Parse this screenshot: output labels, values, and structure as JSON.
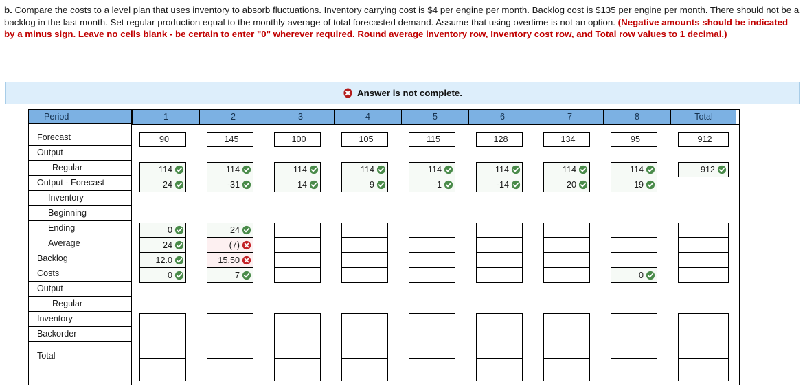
{
  "question": {
    "lead": "b.",
    "body": " Compare the costs to a level plan that uses inventory to absorb fluctuations. Inventory carrying cost is $4 per engine per month. Backlog cost is $135 per engine per month. There should not be a backlog in the last month. Set regular production equal to the monthly average of total forecasted demand. Assume that using overtime is not an option. ",
    "warning": "(Negative amounts should be indicated by a minus sign. Leave no cells blank - be certain to enter \"0\" wherever required. Round average inventory row, Inventory cost row, and Total row values to 1 decimal.)"
  },
  "banner": {
    "icon": "error-circle-x-icon",
    "text": "Answer is not complete."
  },
  "colors": {
    "header_blue": "#7cb1e3",
    "banner_blue": "#ddeefb",
    "correct_green": "#4a8b4a",
    "incorrect_red": "#c32126",
    "warning_red": "#c00000"
  },
  "table": {
    "corner_label": "Period",
    "period_headers": [
      "1",
      "2",
      "3",
      "4",
      "5",
      "6",
      "7",
      "8"
    ],
    "total_header": "Total",
    "row_labels": {
      "forecast": "Forecast",
      "output": "Output",
      "regular": "Regular",
      "output_minus_forecast": "Output - Forecast",
      "inventory": "Inventory",
      "beginning": "Beginning",
      "ending": "Ending",
      "average": "Average",
      "backlog": "Backlog",
      "costs": "Costs",
      "costs_output": "Output",
      "costs_regular": "Regular",
      "costs_inventory": "Inventory",
      "costs_backorder": "Backorder",
      "costs_total": "Total"
    },
    "forecast": {
      "values": [
        "90",
        "145",
        "100",
        "105",
        "115",
        "128",
        "134",
        "95"
      ],
      "total": "912"
    },
    "regular": {
      "values": [
        "114",
        "114",
        "114",
        "114",
        "114",
        "114",
        "114",
        "114"
      ],
      "status": [
        "ok",
        "ok",
        "ok",
        "ok",
        "ok",
        "ok",
        "ok",
        "ok"
      ],
      "total": "912",
      "total_status": "ok"
    },
    "output_minus_forecast": {
      "values": [
        "24",
        "-31",
        "14",
        "9",
        "-1",
        "-14",
        "-20",
        "19"
      ],
      "status": [
        "ok",
        "ok",
        "ok",
        "ok",
        "ok",
        "ok",
        "ok",
        "ok"
      ],
      "total": "",
      "total_status": "empty"
    },
    "beginning": {
      "values": [
        "0",
        "24",
        "",
        "",
        "",
        "",
        "",
        ""
      ],
      "status": [
        "ok",
        "ok",
        "empty",
        "empty",
        "empty",
        "empty",
        "empty",
        "empty"
      ],
      "total": "",
      "total_status": "empty"
    },
    "ending": {
      "values": [
        "24",
        "(7)",
        "",
        "",
        "",
        "",
        "",
        ""
      ],
      "status": [
        "ok",
        "bad",
        "empty",
        "empty",
        "empty",
        "empty",
        "empty",
        "empty"
      ],
      "total": "",
      "total_status": "empty"
    },
    "average": {
      "values": [
        "12.0",
        "15.50",
        "",
        "",
        "",
        "",
        "",
        ""
      ],
      "status": [
        "ok",
        "bad",
        "empty",
        "empty",
        "empty",
        "empty",
        "empty",
        "empty"
      ],
      "total": "",
      "total_status": "empty"
    },
    "backlog": {
      "values": [
        "0",
        "7",
        "",
        "",
        "",
        "",
        "",
        "0"
      ],
      "status": [
        "ok",
        "ok",
        "empty",
        "empty",
        "empty",
        "empty",
        "empty",
        "ok"
      ],
      "total": "",
      "total_status": "empty"
    },
    "costs_regular": {
      "values": [
        "",
        "",
        "",
        "",
        "",
        "",
        "",
        ""
      ],
      "status": [
        "empty",
        "empty",
        "empty",
        "empty",
        "empty",
        "empty",
        "empty",
        "empty"
      ],
      "total": "",
      "total_status": "empty"
    },
    "costs_inventory": {
      "values": [
        "",
        "",
        "",
        "",
        "",
        "",
        "",
        ""
      ],
      "status": [
        "empty",
        "empty",
        "empty",
        "empty",
        "empty",
        "empty",
        "empty",
        "empty"
      ],
      "total": "",
      "total_status": "empty"
    },
    "costs_backorder": {
      "values": [
        "",
        "",
        "",
        "",
        "",
        "",
        "",
        ""
      ],
      "status": [
        "empty",
        "empty",
        "empty",
        "empty",
        "empty",
        "empty",
        "empty",
        "empty"
      ],
      "total": "",
      "total_status": "empty"
    },
    "costs_total": {
      "values": [
        "",
        "",
        "",
        "",
        "",
        "",
        "",
        ""
      ],
      "status": [
        "empty",
        "empty",
        "empty",
        "empty",
        "empty",
        "empty",
        "empty",
        "empty"
      ],
      "total": "",
      "total_status": "empty"
    }
  }
}
